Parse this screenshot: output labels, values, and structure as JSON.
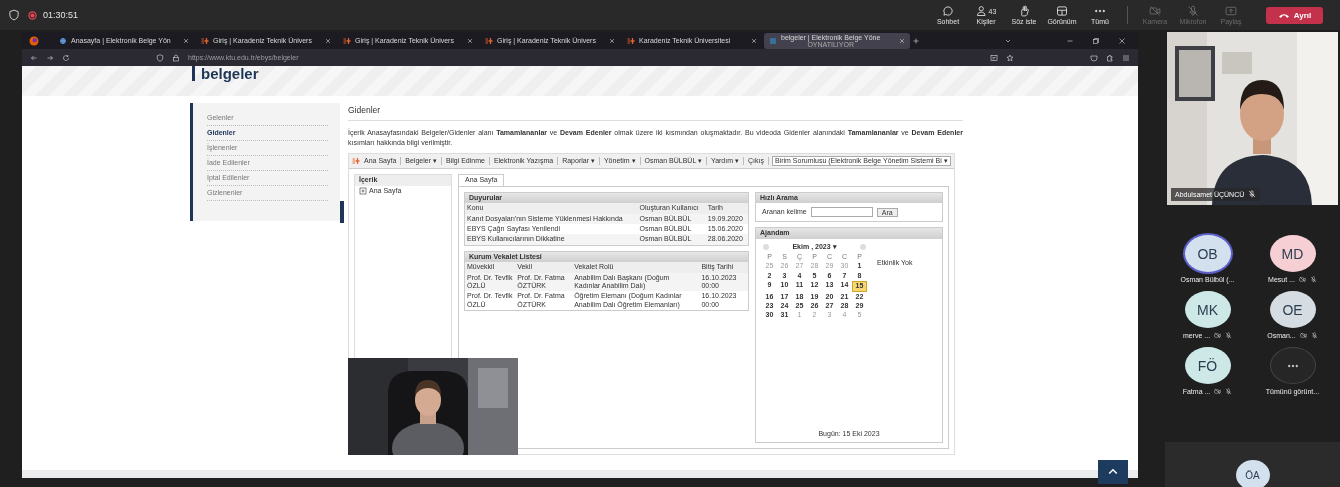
{
  "meeting_bar": {
    "timer": "01:30:51",
    "recording": true,
    "actions": [
      {
        "kind": "chat",
        "label": "Sohbet",
        "disabled": false
      },
      {
        "kind": "people",
        "label": "Kişiler",
        "count": "43",
        "disabled": false
      },
      {
        "kind": "hand",
        "label": "Söz iste",
        "disabled": false
      },
      {
        "kind": "view",
        "label": "Görünüm",
        "disabled": false
      },
      {
        "kind": "more",
        "label": "Tümü",
        "disabled": false
      },
      {
        "kind": "camera",
        "label": "Kamera",
        "disabled": true
      },
      {
        "kind": "mic",
        "label": "Mikrofon",
        "disabled": true
      },
      {
        "kind": "share",
        "label": "Paylaş",
        "disabled": true
      }
    ],
    "leave_button": "Ayrıl"
  },
  "browser": {
    "tabs": [
      {
        "kind": "globe",
        "title": "Anasayfa | Elektronik Belge Yön",
        "selected": false
      },
      {
        "kind": "logo",
        "title": "Giriş | Karadeniz Teknik Ünivers",
        "selected": false
      },
      {
        "kind": "logo",
        "title": "Giriş | Karadeniz Teknik Ünivers",
        "selected": false
      },
      {
        "kind": "logo",
        "title": "Giriş | Karadeniz Teknik Ünivers",
        "selected": false
      },
      {
        "kind": "logo",
        "title": "Karadeniz Teknik Üniversitesi",
        "selected": false
      },
      {
        "kind": "page",
        "title": "belgeler | Elektronik Belge Yöne",
        "status": "OYNATILIYOR",
        "selected": true
      }
    ],
    "address": "https://www.ktu.edu.tr/ebys/belgeler"
  },
  "page": {
    "heading": "belgeler",
    "menu": [
      {
        "label": "Gelenler",
        "selected": false
      },
      {
        "label": "Gidenler",
        "selected": true
      },
      {
        "label": "İşlenenler",
        "selected": false
      },
      {
        "label": "İade Edilenler",
        "selected": false
      },
      {
        "label": "İptal Edilenler",
        "selected": false
      },
      {
        "label": "Gizlenenler",
        "selected": false
      }
    ],
    "title": "Gidenler",
    "paragraph": "İçerik Anasayfasındaki Belgeler/Gidenler alanı **Tamamlananlar** ve **Devam Edenler** olmak üzere iki kısmından oluşmaktadır. Bu videoda Gidenler alanındaki **Tamamlananlar** ve **Devam Edenler** kısımları hakkında bilgi verilmiştir.",
    "screenshot": {
      "menu": [
        "Ana Sayfa",
        "Belgeler ▾",
        "Bilgi Edinme",
        "Elektronik Yazışma",
        "Raporlar ▾",
        "Yönetim ▾",
        "Osman BÜLBÜL ▾",
        "Yardım ▾",
        "Çıkış"
      ],
      "role": "Birim Sorumlusu (Elektronik Belge Yönetim Sistemi Bi ▾",
      "tree_title": "İçerik",
      "tree_items": [
        "Ana Sayfa"
      ],
      "tab": "Ana Sayfa",
      "announcements": {
        "title": "Duyurular",
        "columns": [
          "Konu",
          "Oluşturan Kullanıcı",
          "Tarih"
        ],
        "rows": [
          [
            "Kanıt Dosyaları'nın Sisteme Yüklenmesi Hakkında",
            "Osman BÜLBÜL",
            "19.09.2020"
          ],
          [
            "EBYS Çağrı Sayfası Yenilendi",
            "Osman BÜLBÜL",
            "15.06.2020"
          ],
          [
            "EBYS Kullanıcılarının Dikkatine",
            "Osman BÜLBÜL",
            "28.06.2020"
          ]
        ]
      },
      "proxies": {
        "title": "Kurum Vekalet Listesi",
        "columns": [
          "Müvekkil",
          "Vekil",
          "Vekalet Rolü",
          "Bitiş Tarihi"
        ],
        "rows": [
          [
            "Prof. Dr. Tevfik ÖZLÜ",
            "Prof. Dr. Fatma ÖZTÜRK",
            "Anabilim Dalı Başkanı (Doğum Kadınlar Anabilim Dalı)",
            "16.10.2023 00:00"
          ],
          [
            "Prof. Dr. Tevfik ÖZLÜ",
            "Prof. Dr. Fatma ÖZTÜRK",
            "Öğretim Elemanı (Doğum Kadınlar Anabilim Dalı Öğretim Elemanları)",
            "16.10.2023 00:00"
          ]
        ]
      },
      "search": {
        "title": "Hızlı Arama",
        "label": "Aranan kelime",
        "button": "Ara"
      },
      "agenda": {
        "title": "Ajandam",
        "month": "Ekim , 2023 ▾",
        "weekdays": [
          "P",
          "S",
          "Ç",
          "P",
          "C",
          "C",
          "P"
        ],
        "weeks": [
          [
            {
              "day": "25",
              "other_month": true,
              "selected": false
            },
            {
              "day": "26",
              "other_month": true,
              "selected": false
            },
            {
              "day": "27",
              "other_month": true,
              "selected": false
            },
            {
              "day": "28",
              "other_month": true,
              "selected": false
            },
            {
              "day": "29",
              "other_month": true,
              "selected": false
            },
            {
              "day": "30",
              "other_month": true,
              "selected": false
            },
            {
              "day": "1",
              "other_month": false,
              "selected": false
            }
          ],
          [
            {
              "day": "2",
              "other_month": false,
              "selected": false
            },
            {
              "day": "3",
              "other_month": false,
              "selected": false
            },
            {
              "day": "4",
              "other_month": false,
              "selected": false
            },
            {
              "day": "5",
              "other_month": false,
              "selected": false
            },
            {
              "day": "6",
              "other_month": false,
              "selected": false
            },
            {
              "day": "7",
              "other_month": false,
              "selected": false
            },
            {
              "day": "8",
              "other_month": false,
              "selected": false
            }
          ],
          [
            {
              "day": "9",
              "other_month": false,
              "selected": false
            },
            {
              "day": "10",
              "other_month": false,
              "selected": false
            },
            {
              "day": "11",
              "other_month": false,
              "selected": false
            },
            {
              "day": "12",
              "other_month": false,
              "selected": false
            },
            {
              "day": "13",
              "other_month": false,
              "selected": false
            },
            {
              "day": "14",
              "other_month": false,
              "selected": false
            },
            {
              "day": "15",
              "other_month": false,
              "selected": true
            }
          ],
          [
            {
              "day": "16",
              "other_month": false,
              "selected": false
            },
            {
              "day": "17",
              "other_month": false,
              "selected": false
            },
            {
              "day": "18",
              "other_month": false,
              "selected": false
            },
            {
              "day": "19",
              "other_month": false,
              "selected": false
            },
            {
              "day": "20",
              "other_month": false,
              "selected": false
            },
            {
              "day": "21",
              "other_month": false,
              "selected": false
            },
            {
              "day": "22",
              "other_month": false,
              "selected": false
            }
          ],
          [
            {
              "day": "23",
              "other_month": false,
              "selected": false
            },
            {
              "day": "24",
              "other_month": false,
              "selected": false
            },
            {
              "day": "25",
              "other_month": false,
              "selected": false
            },
            {
              "day": "26",
              "other_month": false,
              "selected": false
            },
            {
              "day": "27",
              "other_month": false,
              "selected": false
            },
            {
              "day": "28",
              "other_month": false,
              "selected": false
            },
            {
              "day": "29",
              "other_month": false,
              "selected": false
            }
          ],
          [
            {
              "day": "30",
              "other_month": false,
              "selected": false
            },
            {
              "day": "31",
              "other_month": false,
              "selected": false
            },
            {
              "day": "1",
              "other_month": true,
              "selected": false
            },
            {
              "day": "2",
              "other_month": true,
              "selected": false
            },
            {
              "day": "3",
              "other_month": true,
              "selected": false
            },
            {
              "day": "4",
              "other_month": true,
              "selected": false
            },
            {
              "day": "5",
              "other_month": true,
              "selected": false
            }
          ]
        ],
        "no_events": "Etkinlik Yok",
        "today": "Bugün: 15 Eki 2023"
      }
    }
  },
  "speaker_video": {
    "name": "Abdulsamet ÜÇÜNCÜ",
    "muted": true
  },
  "participants": [
    {
      "initials": "OB",
      "name": "Osman Bülbül (...",
      "color": "#d3e0ee",
      "speaking": true,
      "muted": false
    },
    {
      "initials": "MD",
      "name": "Mesut ...",
      "color": "#f5cfd3",
      "speaking": false,
      "muted": true
    },
    {
      "initials": "MK",
      "name": "merve ...",
      "color": "#cde8e6",
      "speaking": false,
      "muted": true
    },
    {
      "initials": "OE",
      "name": "Osman...",
      "color": "#d5dde2",
      "speaking": false,
      "muted": true
    },
    {
      "initials": "FÖ",
      "name": "Fatma ...",
      "color": "#cde8e6",
      "speaking": false,
      "muted": true
    }
  ],
  "show_all": {
    "label": "Tümünü görünt..."
  },
  "pinned_participant": {
    "initials": "ÖA",
    "color": "#d3e0ee"
  }
}
